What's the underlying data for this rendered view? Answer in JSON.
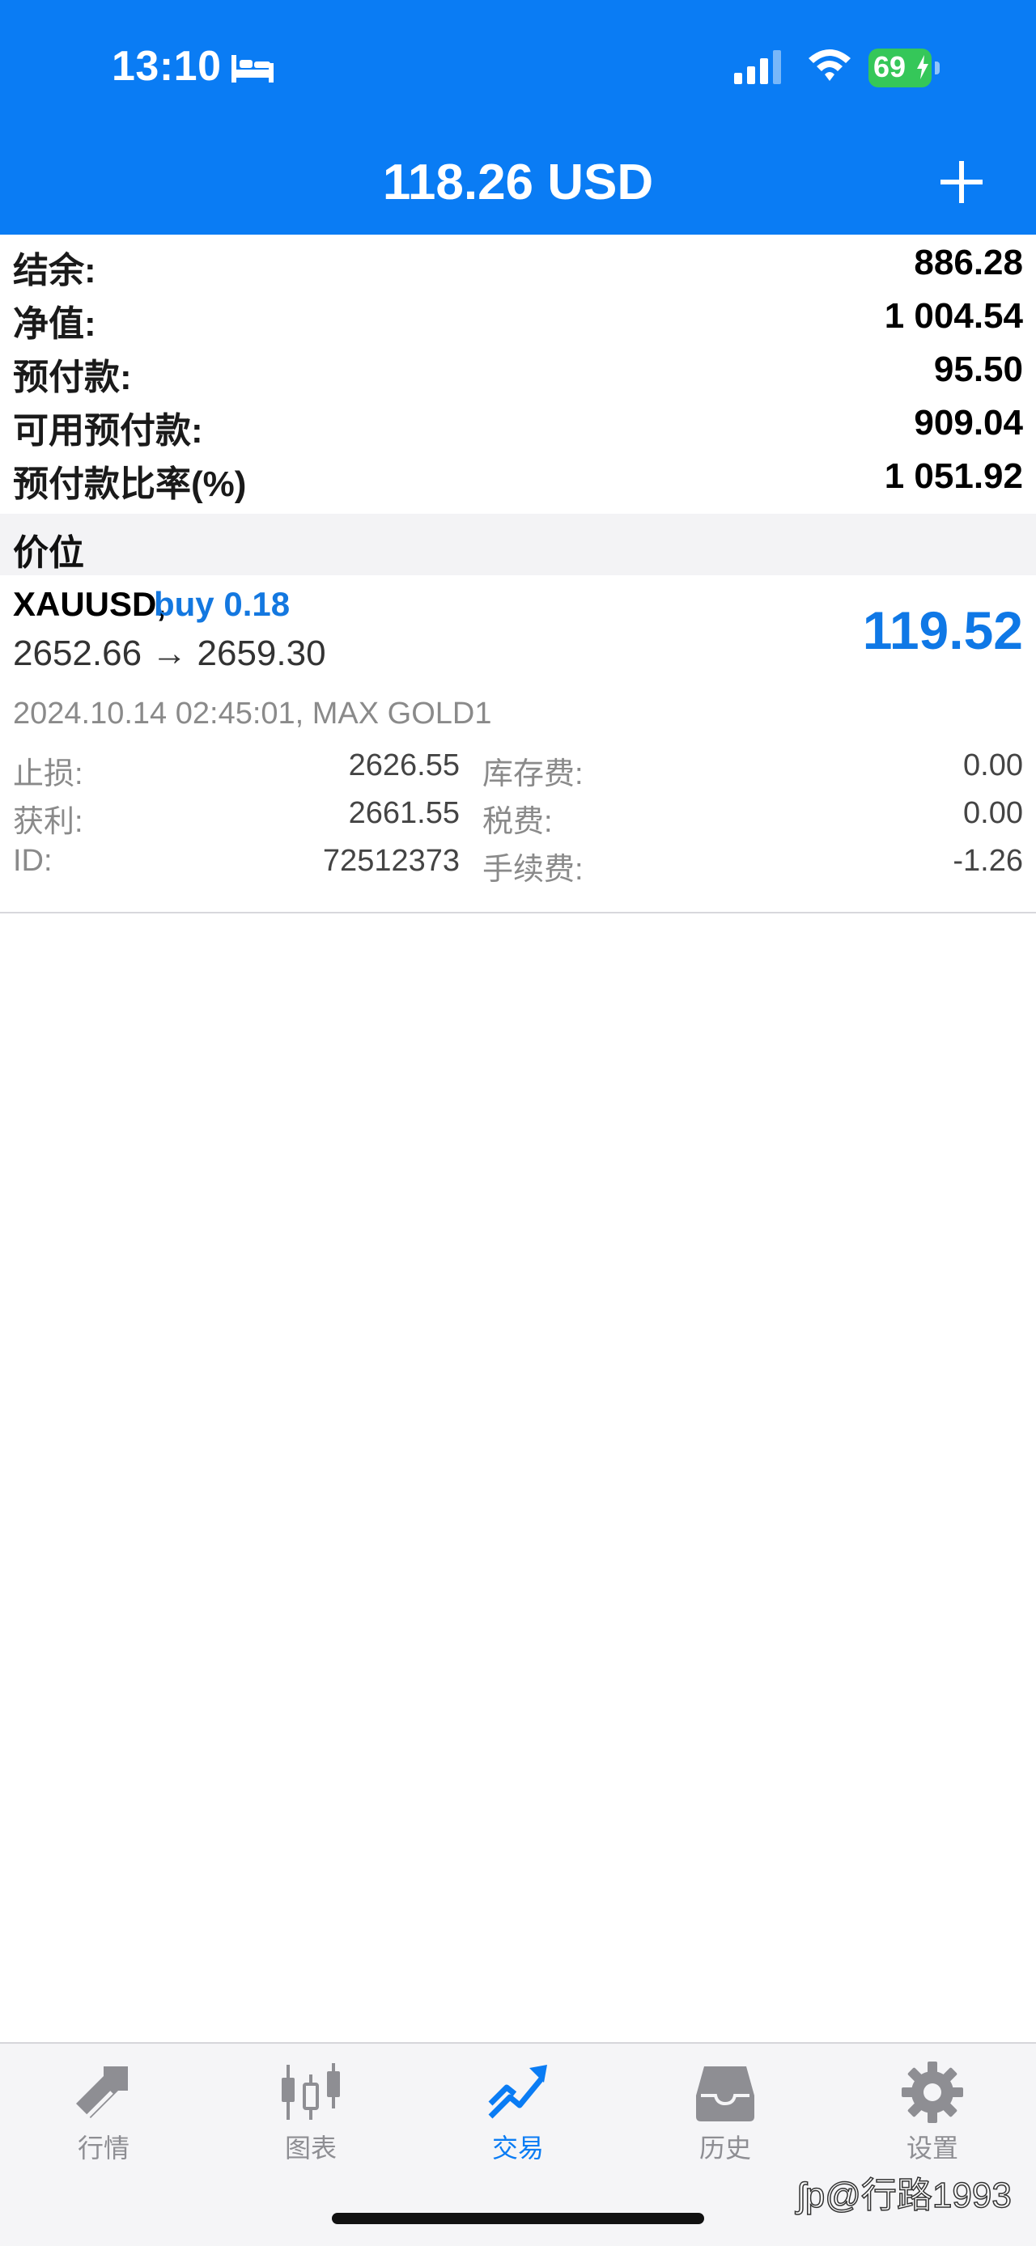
{
  "status_bar": {
    "time": "13:10",
    "battery_level": "69",
    "icons": [
      "bed-icon",
      "signal-icon",
      "wifi-icon",
      "battery-icon"
    ]
  },
  "header": {
    "title": "118.26 USD",
    "add_icon": "plus-icon"
  },
  "summary": [
    {
      "label": "结余:",
      "value": "886.28"
    },
    {
      "label": "净值:",
      "value": "1 004.54"
    },
    {
      "label": "预付款:",
      "value": "95.50"
    },
    {
      "label": "可用预付款:",
      "value": "909.04"
    },
    {
      "label": "预付款比率(%)",
      "value": "1 051.92"
    }
  ],
  "section": {
    "title": "价位"
  },
  "position": {
    "symbol": "XAUUSD,",
    "side": "buy 0.18",
    "prices": "2652.66 → 2659.30",
    "profit": "119.52",
    "meta": "2024.10.14 02:45:01, MAX GOLD1",
    "details": [
      {
        "label": "止损:",
        "value": "2626.55",
        "label2": "库存费:",
        "value2": "0.00"
      },
      {
        "label": "获利:",
        "value": "2661.55",
        "label2": "税费:",
        "value2": "0.00"
      },
      {
        "label": "ID:",
        "value": "72512373",
        "label2": "手续费:",
        "value2": "-1.26"
      }
    ]
  },
  "tabs": [
    {
      "label": "行情",
      "icon": "quotes-icon",
      "active": false
    },
    {
      "label": "图表",
      "icon": "chart-icon",
      "active": false
    },
    {
      "label": "交易",
      "icon": "trade-icon",
      "active": true
    },
    {
      "label": "历史",
      "icon": "history-icon",
      "active": false
    },
    {
      "label": "设置",
      "icon": "settings-icon",
      "active": false
    }
  ],
  "watermark": "ʃp@行路1993",
  "colors": {
    "header_blue": "#0a7cf4",
    "accent_blue": "#0f78e6",
    "battery_green": "#35c759",
    "tab_inactive": "#8e8e93"
  }
}
